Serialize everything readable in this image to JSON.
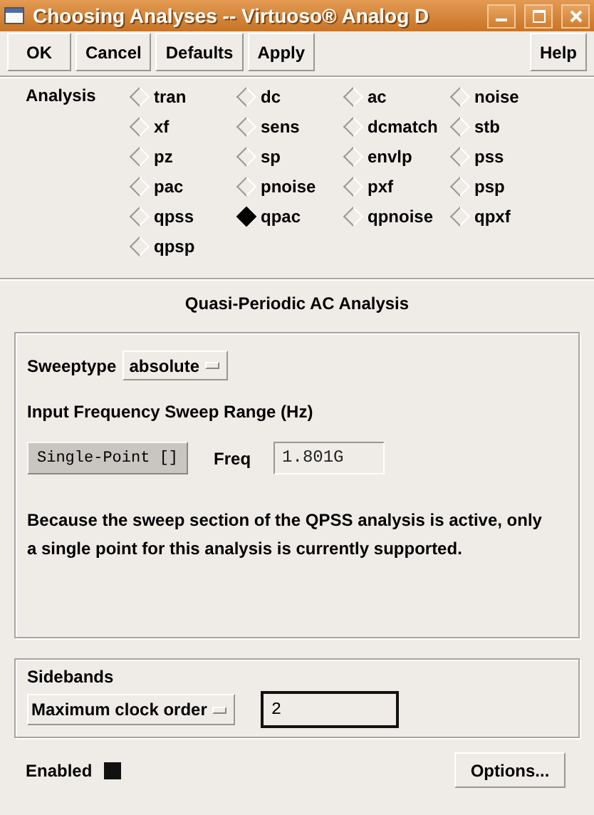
{
  "window": {
    "title": "Choosing Analyses -- Virtuoso® Analog D"
  },
  "toolbar": {
    "buttons": [
      "OK",
      "Cancel",
      "Defaults",
      "Apply"
    ],
    "help": "Help"
  },
  "analysis": {
    "label": "Analysis",
    "options": [
      {
        "label": "tran",
        "selected": false
      },
      {
        "label": "dc",
        "selected": false
      },
      {
        "label": "ac",
        "selected": false
      },
      {
        "label": "noise",
        "selected": false
      },
      {
        "label": "xf",
        "selected": false
      },
      {
        "label": "sens",
        "selected": false
      },
      {
        "label": "dcmatch",
        "selected": false
      },
      {
        "label": "stb",
        "selected": false
      },
      {
        "label": "pz",
        "selected": false
      },
      {
        "label": "sp",
        "selected": false
      },
      {
        "label": "envlp",
        "selected": false
      },
      {
        "label": "pss",
        "selected": false
      },
      {
        "label": "pac",
        "selected": false
      },
      {
        "label": "pnoise",
        "selected": false
      },
      {
        "label": "pxf",
        "selected": false
      },
      {
        "label": "psp",
        "selected": false
      },
      {
        "label": "qpss",
        "selected": false
      },
      {
        "label": "qpac",
        "selected": true
      },
      {
        "label": "qpnoise",
        "selected": false
      },
      {
        "label": "qpxf",
        "selected": false
      },
      {
        "label": "qpsp",
        "selected": false
      }
    ]
  },
  "section_title": "Quasi-Periodic AC Analysis",
  "sweep": {
    "sweeptype_label": "Sweeptype",
    "sweeptype_value": "absolute",
    "range_label": "Input Frequency Sweep Range (Hz)",
    "mode_button": "Single-Point []",
    "freq_label": "Freq",
    "freq_value": "1.801G",
    "note": "Because the sweep section of the QPSS analysis is active, only a single point for this analysis is currently supported."
  },
  "sidebands": {
    "label": "Sidebands",
    "method": "Maximum clock order",
    "value": "2"
  },
  "enabled": {
    "label": "Enabled",
    "checked": true
  },
  "options_button": "Options..."
}
